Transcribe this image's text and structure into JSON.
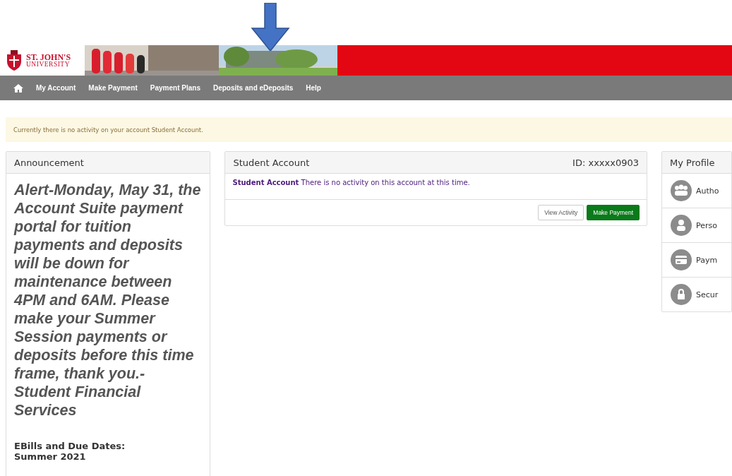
{
  "header": {
    "logo_line1": "ST. JOHN'S",
    "logo_line2": "UNIVERSITY"
  },
  "nav": {
    "items": [
      {
        "label": "My Account"
      },
      {
        "label": "Make Payment"
      },
      {
        "label": "Payment Plans"
      },
      {
        "label": "Deposits and eDeposits"
      },
      {
        "label": "Help"
      }
    ]
  },
  "alert": "Currently there is no activity on your account Student Account.",
  "announcement": {
    "title": "Announcement",
    "message": "Alert-Monday, May 31, the Account Suite payment portal for tuition payments and deposits will be down for maintenance between 4PM and 6AM. Please make your Summer Session payments or deposits before this time frame, thank you.- Student Financial Services",
    "heading": "EBills and Due Dates:",
    "term": "Summer 2021"
  },
  "account": {
    "title": "Student Account",
    "id": "ID: xxxxx0903",
    "message": "**Student Account** There is no activity on this account at this time.",
    "buttons": [
      {
        "label": "View Activity",
        "kind": "default"
      },
      {
        "label": "Make Payment",
        "kind": "primary"
      }
    ]
  },
  "profile": {
    "title": "My Profile",
    "items": [
      {
        "label": "Autho",
        "kind": "people"
      },
      {
        "label": "Perso",
        "kind": "person"
      },
      {
        "label": "Paym",
        "kind": "card"
      },
      {
        "label": "Secur",
        "kind": "lock"
      }
    ]
  }
}
